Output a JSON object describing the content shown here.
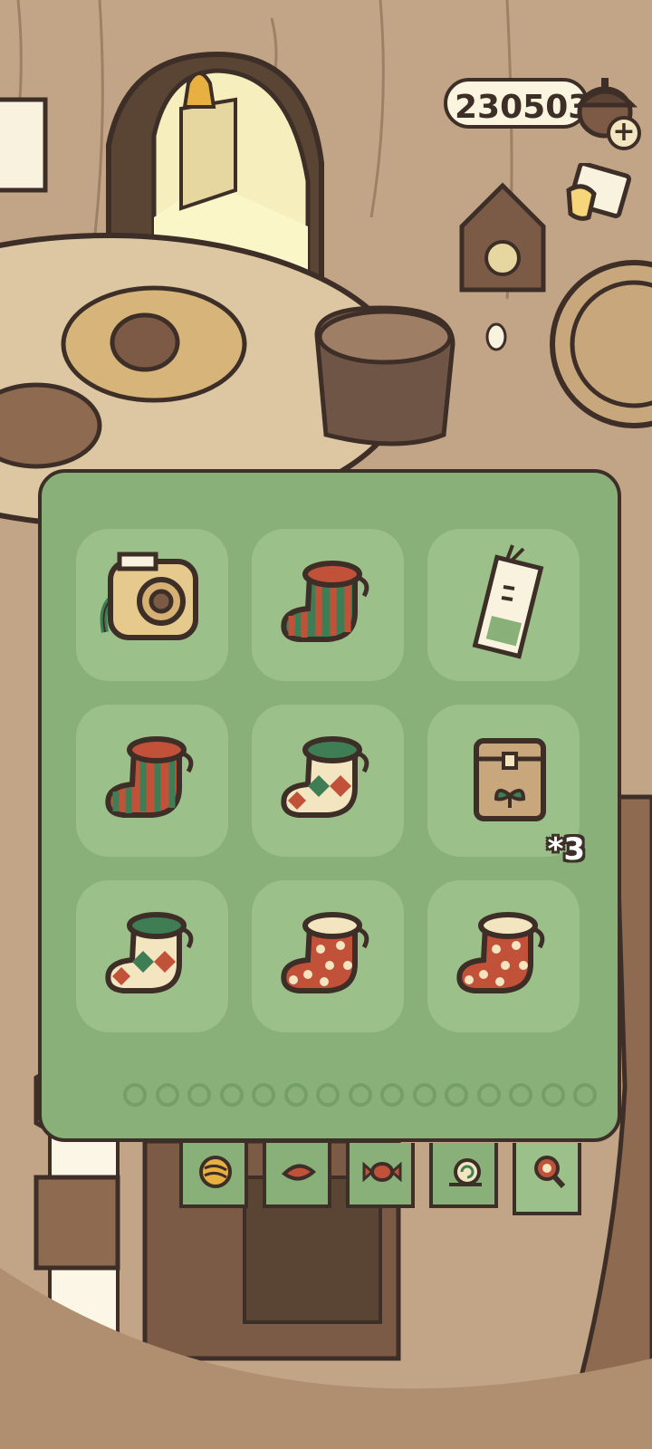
{
  "currency": {
    "clover_count": "230503",
    "icon": "acorn-icon",
    "add_icon": "plus-icon"
  },
  "mail": {
    "icon": "mail-icon"
  },
  "inventory": {
    "items": [
      {
        "name": "camera",
        "count": ""
      },
      {
        "name": "striped-sock-green-red",
        "count": ""
      },
      {
        "name": "charm-ticket",
        "count": ""
      },
      {
        "name": "striped-sock-red-green",
        "count": ""
      },
      {
        "name": "diamond-sock-green",
        "count": ""
      },
      {
        "name": "seed-bag",
        "count": "*3"
      },
      {
        "name": "diamond-sock-green-2",
        "count": ""
      },
      {
        "name": "polka-sock-cream",
        "count": ""
      },
      {
        "name": "polka-sock-cream-2",
        "count": ""
      }
    ],
    "page_count": 15,
    "current_page": 1
  },
  "tabs": [
    {
      "name": "yarn",
      "icon": "yarn-icon"
    },
    {
      "name": "leaf",
      "icon": "leaf-icon"
    },
    {
      "name": "candy",
      "icon": "candy-icon"
    },
    {
      "name": "snail",
      "icon": "snail-icon"
    },
    {
      "name": "search",
      "icon": "magnifier-icon",
      "active": true
    }
  ],
  "colors": {
    "panel": "#88b078",
    "slot": "#9cc089",
    "outline": "#3d2f28"
  }
}
